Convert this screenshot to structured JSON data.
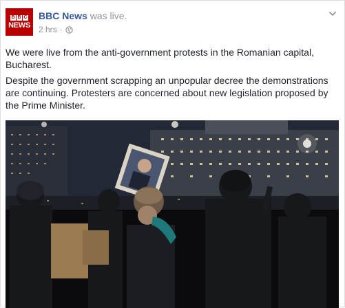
{
  "post": {
    "page_name": "BBC News",
    "status": "was live.",
    "time": "2 hrs",
    "separator": "·",
    "privacy_icon": "globe-icon",
    "menu_icon": "chevron-down-icon",
    "avatar": {
      "letters": [
        "B",
        "B",
        "C"
      ],
      "word": "NEWS"
    },
    "paragraphs": [
      "We were live from the anti-government protests in the Romanian capital, Bucharest.",
      "Despite the government scrapping an unpopular decree the demonstrations are continuing. Protesters are concerned about new legislation proposed by the Prime Minister."
    ]
  },
  "colors": {
    "brand_red": "#b80000",
    "link_blue": "#365899",
    "meta_gray": "#90949c",
    "text": "#1d2129"
  }
}
